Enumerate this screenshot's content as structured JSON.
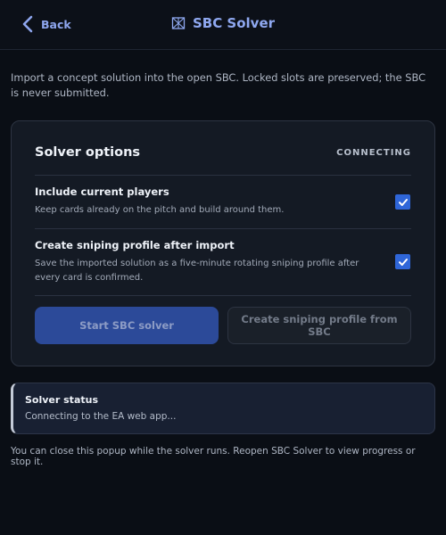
{
  "header": {
    "back_label": "Back",
    "title": "SBC Solver",
    "title_icon": "sbc-grid-icon"
  },
  "intro": "Import a concept solution into the open SBC. Locked slots are preserved; the SBC is never submitted.",
  "panel": {
    "title": "Solver options",
    "connection_status": "CONNECTING",
    "options": [
      {
        "label": "Include current players",
        "description": "Keep cards already on the pitch and build around them.",
        "checked": true
      },
      {
        "label": "Create sniping profile after import",
        "description": "Save the imported solution as a five-minute rotating sniping profile after every card is confirmed.",
        "checked": true
      }
    ],
    "start_button": "Start SBC solver",
    "profile_button": "Create sniping profile from SBC"
  },
  "status": {
    "title": "Solver status",
    "message": "Connecting to the EA web app..."
  },
  "footer": "You can close this popup while the solver runs. Reopen SBC Solver to view progress or stop it.",
  "colors": {
    "background": "#0a0e15",
    "accent": "#8fa8f0",
    "checkbox": "#2f66d8",
    "primary_button": "#2c4a99"
  }
}
